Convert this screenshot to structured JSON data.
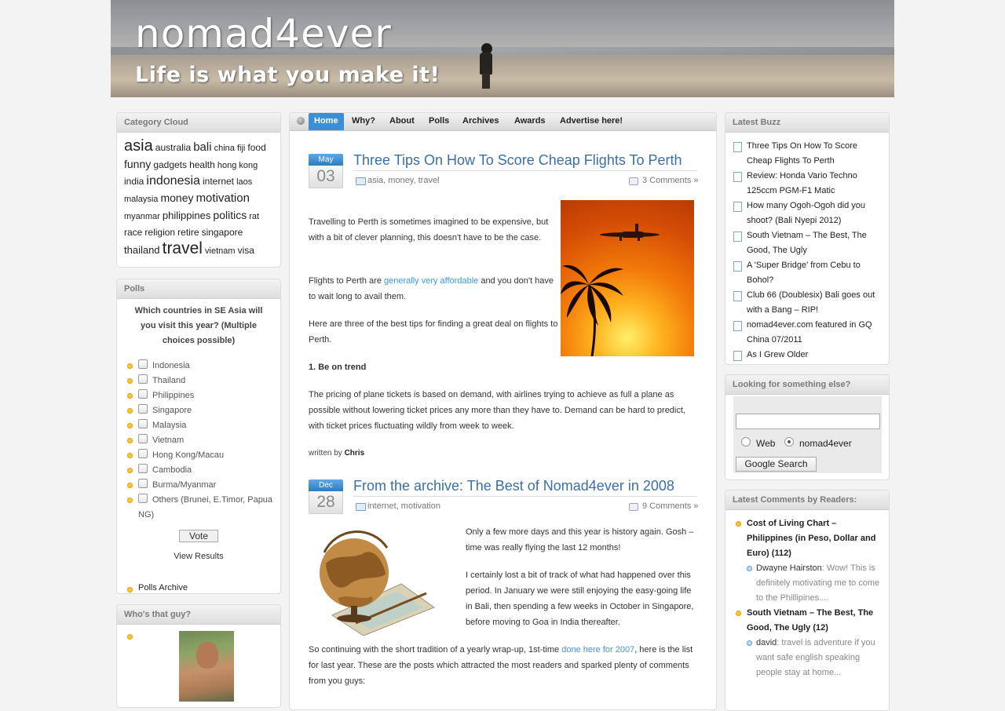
{
  "header": {
    "title": "nomad4ever",
    "tagline": "Life is what you make it!"
  },
  "category_cloud": {
    "title": "Category Cloud",
    "tags": [
      {
        "label": "asia",
        "size": 20
      },
      {
        "label": "australia",
        "size": 12
      },
      {
        "label": "bali",
        "size": 15
      },
      {
        "label": "china",
        "size": 11
      },
      {
        "label": "fiji",
        "size": 11
      },
      {
        "label": "food",
        "size": 12
      },
      {
        "label": "funny",
        "size": 14
      },
      {
        "label": "gadgets",
        "size": 12
      },
      {
        "label": "health",
        "size": 12
      },
      {
        "label": "hong kong",
        "size": 11
      },
      {
        "label": "india",
        "size": 12
      },
      {
        "label": "indonesia",
        "size": 16
      },
      {
        "label": "internet",
        "size": 12
      },
      {
        "label": "laos",
        "size": 11
      },
      {
        "label": "malaysia",
        "size": 11
      },
      {
        "label": "money",
        "size": 14
      },
      {
        "label": "motivation",
        "size": 15
      },
      {
        "label": "myanmar",
        "size": 11
      },
      {
        "label": "philippines",
        "size": 13
      },
      {
        "label": "politics",
        "size": 14
      },
      {
        "label": "rat",
        "size": 11
      },
      {
        "label": "race",
        "size": 12
      },
      {
        "label": "religion",
        "size": 12
      },
      {
        "label": "retire",
        "size": 12
      },
      {
        "label": "singapore",
        "size": 12
      },
      {
        "label": "thailand",
        "size": 13
      },
      {
        "label": "travel",
        "size": 21
      },
      {
        "label": "vietnam",
        "size": 11
      },
      {
        "label": "visa",
        "size": 12
      }
    ]
  },
  "polls": {
    "title": "Polls",
    "question": "Which countries in SE Asia will you visit this year? (Multiple choices possible)",
    "options": [
      "Indonesia",
      "Thailand",
      "Philippines",
      "Singapore",
      "Malaysia",
      "Vietnam",
      "Hong Kong/Macau",
      "Cambodia",
      "Burma/Myanmar",
      "Others (Brunei, E.Timor, Papua NG)"
    ],
    "vote_label": "Vote",
    "view_results": "View Results",
    "archive_label": "Polls Archive"
  },
  "who": {
    "title": "Who's that guy?"
  },
  "nav": {
    "items": [
      "Home",
      "Why?",
      "About",
      "Polls",
      "Archives",
      "Awards",
      "Advertise here!"
    ],
    "active": "Home"
  },
  "posts": [
    {
      "month": "May",
      "day": "03",
      "title": "Three Tips On How To Score Cheap Flights To Perth",
      "categories": "asia, money, travel",
      "comments": "3 Comments »",
      "p1": "Travelling to Perth is sometimes imagined to be expensive, but with a bit of clever planning, this doesn't have to be the case.",
      "p2_before": "Flights to Perth are ",
      "p2_link": "generally very affordable",
      "p2_after": " and you don't have to wait long to avail them.",
      "p3": "Here are three of the best tips for finding a great deal on flights to Perth.",
      "heading": "1. Be on trend",
      "p4": "The pricing of plane tickets is based on demand, with airlines trying to achieve as full a plane as possible without lowering ticket prices any more than they have to. Demand can be hard to predict, with ticket prices fluctuating wildly from week to week.",
      "written_by": "written by",
      "author": "Chris"
    },
    {
      "month": "Dec",
      "day": "28",
      "title": "From the archive: The Best of Nomad4ever in 2008",
      "categories": "internet, motivation",
      "comments": "9 Comments »",
      "p1": "Only a few more days and this year is history again. Gosh – time was really flying the last 12 months!",
      "p2": "I certainly lost a bit of track of what had happened over this period. In January we were still enjoying the easy-going life in Bali, then spending a few weeks in October in Singapore, before moving to Goa in India thereafter.",
      "p3_before": "So continuing with the short tradition of a yearly wrap-up, 1st-time ",
      "p3_link": "done here for 2007",
      "p3_after": ", here is the list for last year. These are the posts which attracted the most readers and sparked plenty of comments from you guys:"
    }
  ],
  "buzz": {
    "title": "Latest Buzz",
    "items": [
      "Three Tips On How To Score Cheap Flights To Perth",
      "Review: Honda Vario Techno 125ccm PGM-F1 Matic",
      "How many Ogoh-Ogoh did you shoot? (Bali Nyepi 2012)",
      "South Vietnam – The Best, The Good, The Ugly",
      "A 'Super Bridge' from Cebu to Bohol?",
      "Club 66 (Doublesix) Bali goes out with a Bang – RIP!",
      "nomad4ever.com featured in GQ China 07/2011",
      "As I Grew Older"
    ]
  },
  "search": {
    "title": "Looking for something else?",
    "input_value": "",
    "radio_web": "Web",
    "radio_site": "nomad4ever",
    "selected": "nomad4ever",
    "button": "Google Search"
  },
  "comments": {
    "title": "Latest Comments by Readers:",
    "posts": [
      {
        "title": "Cost of Living Chart – Philippines (in Peso, Dollar and Euro)",
        "count": "112",
        "replies": [
          {
            "author": "Dwayne Hairston",
            "text": ": Wow! This is definitely motivating me to come to the Phillipines...."
          }
        ]
      },
      {
        "title": "South Vietnam – The Best, The Good, The Ugly",
        "count": "12",
        "replies": [
          {
            "author": "david",
            "text": ": travel is adventure if you want safe english speaking people stay at home..."
          }
        ]
      }
    ]
  },
  "colors": {
    "accent": "#3b8fd6",
    "link": "#3a9ad9",
    "title_blue": "#3a6fa8",
    "bullet": "#ffc838"
  }
}
